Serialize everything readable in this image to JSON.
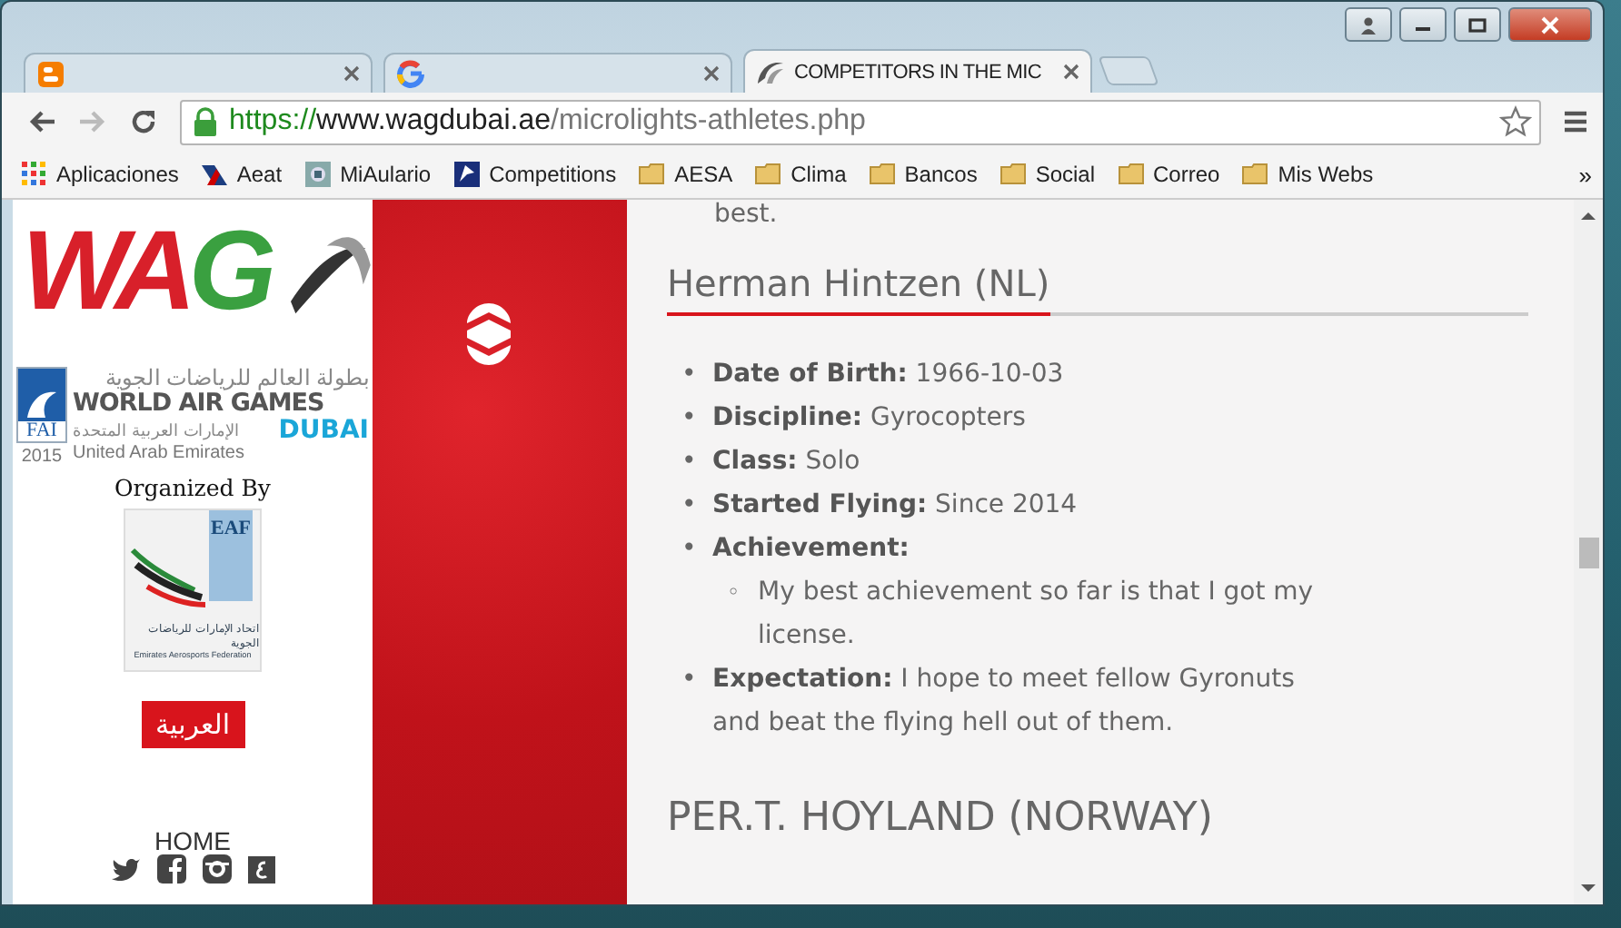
{
  "tabs": [
    {
      "kind": "blogger",
      "selected": false
    },
    {
      "kind": "google",
      "selected": false
    },
    {
      "kind": "wag",
      "title": "COMPETITORS IN THE MIC",
      "selected": true
    }
  ],
  "address": {
    "secure": true,
    "scheme": "https://",
    "host": "www.wagdubai.ae",
    "path": "/microlights-athletes.php"
  },
  "bookmarks": [
    {
      "kind": "apps",
      "label": "Aplicaciones"
    },
    {
      "kind": "aeat",
      "label": "Aeat"
    },
    {
      "kind": "site",
      "label": "MiAulario"
    },
    {
      "kind": "flag",
      "label": "Competitions"
    },
    {
      "kind": "folder",
      "label": "AESA"
    },
    {
      "kind": "folder",
      "label": "Clima"
    },
    {
      "kind": "folder",
      "label": "Bancos"
    },
    {
      "kind": "folder",
      "label": "Social"
    },
    {
      "kind": "folder",
      "label": "Correo"
    },
    {
      "kind": "folder",
      "label": "Mis Webs"
    }
  ],
  "bookmarks_overflow": "»",
  "sidebar": {
    "logo_text": "WAG",
    "games_logo": {
      "arabic_title": "بطولة العالم للرياضات الجوية",
      "title": "WORLD AIR GAMES",
      "fai": "FAI",
      "arabic_country": "الإمارات العربية المتحدة",
      "year": "2015",
      "country": "United Arab Emirates",
      "city": "DUBAI"
    },
    "organized_by": "Organized By",
    "eaf_logo": {
      "initials": "EAF",
      "arabic_name": "اتحاد الإمارات للرياضات الجوية",
      "name": "Emirates Aerosports Federation"
    },
    "language_button": "العربية",
    "nav": "HOME"
  },
  "content": {
    "top_fragment": "best.",
    "bullet": "•",
    "sub_bullet": "◦",
    "athlete": {
      "name": "Herman Hintzen (NL)",
      "facts": [
        {
          "label": "Date of Birth:",
          "value": "1966-10-03"
        },
        {
          "label": "Discipline:",
          "value": "Gyrocopters"
        },
        {
          "label": "Class:",
          "value": "Solo"
        },
        {
          "label": "Started Flying:",
          "value": "Since 2014"
        },
        {
          "label": "Achievement:",
          "children": [
            "My best achievement so far is that I got my license."
          ]
        },
        {
          "label": "Expectation:",
          "value": "I hope to meet fellow Gyronuts and beat the flying hell out of them."
        }
      ]
    },
    "next_heading": "PER.T. HOYLAND (NORWAY)"
  }
}
